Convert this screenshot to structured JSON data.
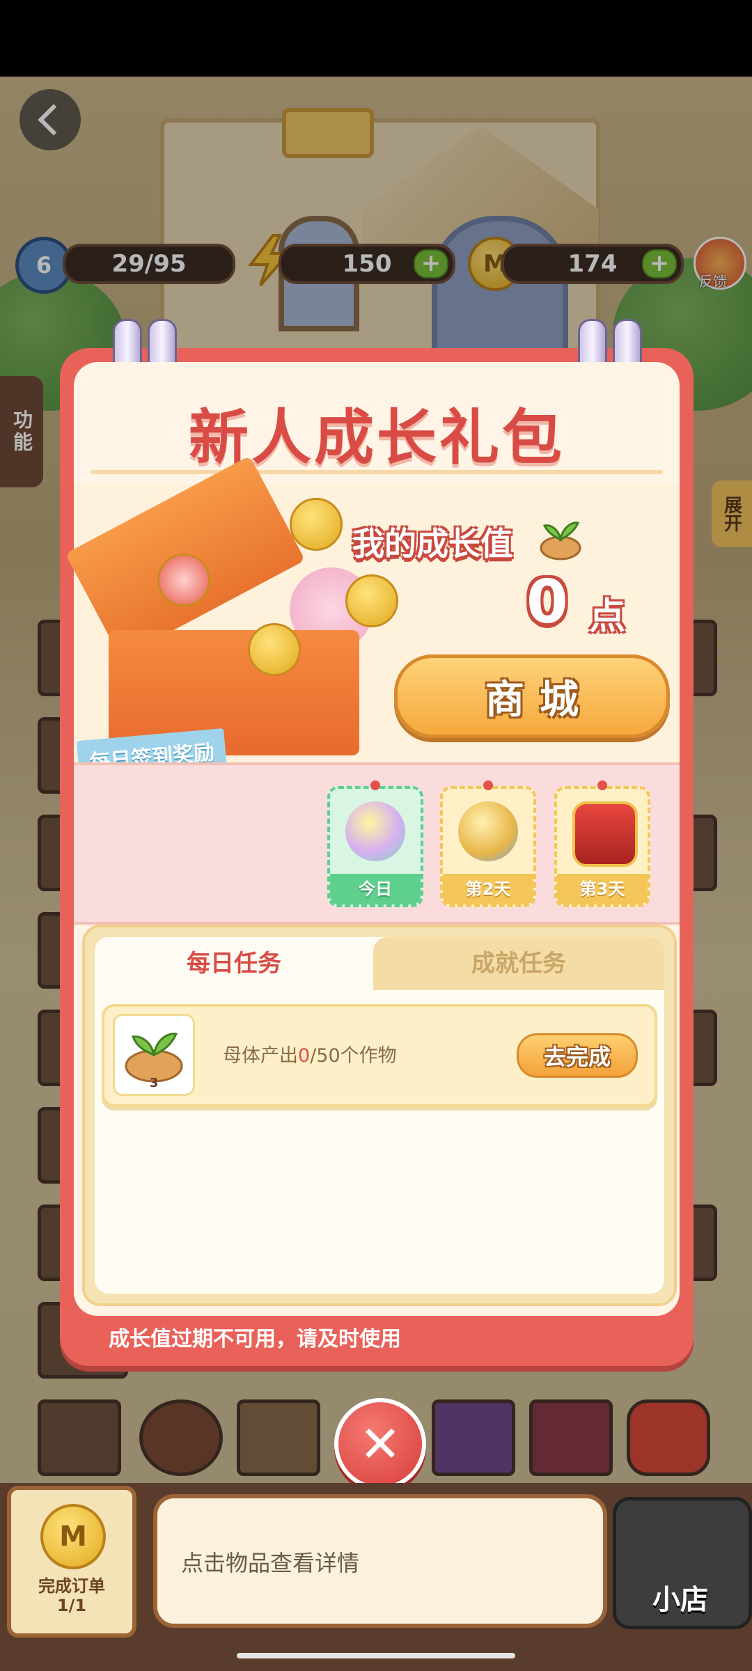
{
  "hud": {
    "level": "6",
    "exp": "29/95",
    "energy": "150",
    "coins": "174",
    "coin_symbol": "M",
    "feedback_label": "反馈"
  },
  "side": {
    "function_label": "功能",
    "expand_label": "展开",
    "badge": "6"
  },
  "modal": {
    "title": "新人成长礼包",
    "growth_label": "我的成长值",
    "growth_value": "0",
    "growth_unit": "点",
    "shop_button": "商城",
    "daily_tag": "每日签到奖励",
    "checkin": [
      {
        "label": "今日",
        "icon": "energy-orb-icon"
      },
      {
        "label": "第2天",
        "icon": "gear-clock-icon"
      },
      {
        "label": "第3天",
        "icon": "treasure-chest-icon"
      }
    ],
    "tabs": {
      "daily": "每日任务",
      "achievement": "成就任务"
    },
    "task": {
      "prefix": "母体产出",
      "progress": "0",
      "suffix": "/50个作物",
      "icon_count": "3",
      "button": "去完成"
    },
    "footer": "成长值过期不可用，请及时使用"
  },
  "bottom": {
    "order_label": "完成订单",
    "order_count": "1/1",
    "detail_hint": "点击物品查看详情",
    "shop_label": "小店"
  },
  "colors": {
    "modal_red": "#e9625a",
    "accent_orange": "#f5a93c",
    "cream": "#fff4e6"
  }
}
